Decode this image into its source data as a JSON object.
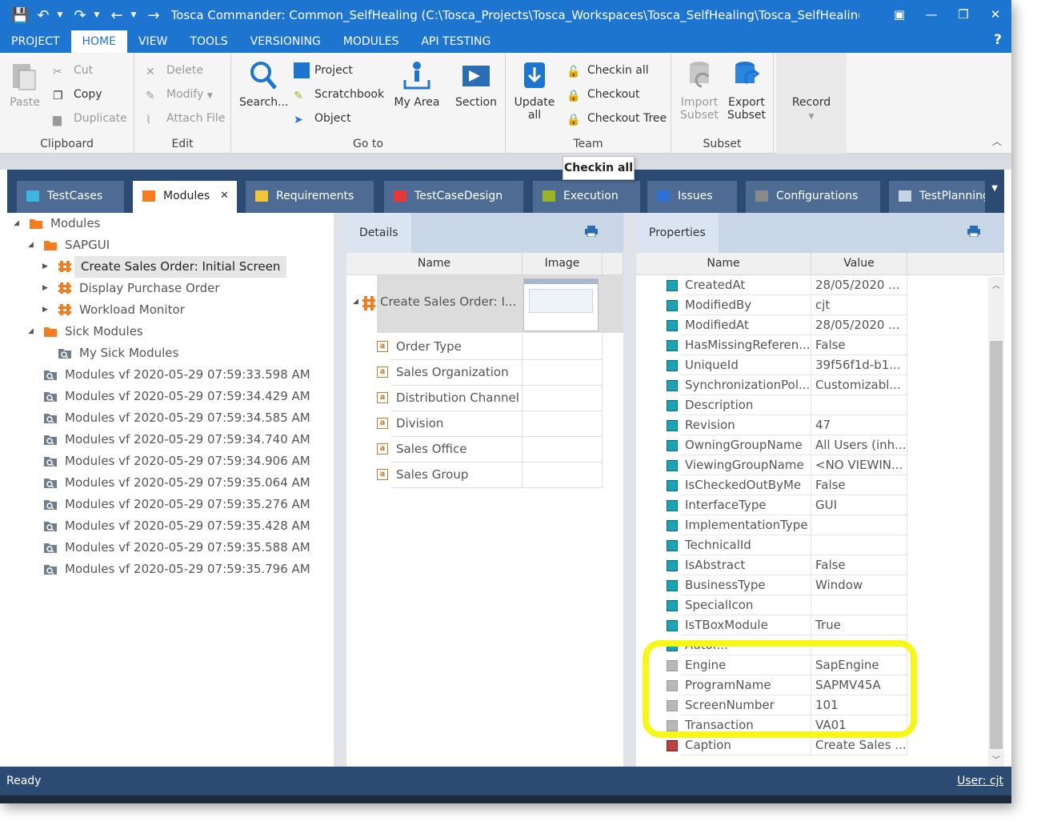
{
  "window": {
    "title": "Tosca Commander: Common_SelfHealing (C:\\Tosca_Projects\\Tosca_Workspaces\\Tosca_SelfHealing\\Tosca_SelfHealing.tws [Bran...",
    "accent": "#1e75cf"
  },
  "menu": {
    "tabs": [
      "PROJECT",
      "HOME",
      "VIEW",
      "TOOLS",
      "VERSIONING",
      "MODULES",
      "API TESTING"
    ],
    "active": "HOME",
    "help": "?"
  },
  "ribbon": {
    "clipboard": {
      "label": "Clipboard",
      "paste": "Paste",
      "cut": "Cut",
      "copy": "Copy",
      "duplicate": "Duplicate"
    },
    "edit": {
      "label": "Edit",
      "delete": "Delete",
      "modify": "Modify",
      "attach_file": "Attach File"
    },
    "goto": {
      "label": "Go to",
      "search": "Search...",
      "project": "Project",
      "scratchbook": "Scratchbook",
      "object": "Object",
      "my_area": "My Area",
      "section": "Section"
    },
    "team": {
      "label": "Team",
      "update_all_1": "Update",
      "update_all_2": "all",
      "checkin_all": "Checkin all",
      "checkout": "Checkout",
      "checkout_tree": "Checkout Tree"
    },
    "subset": {
      "label": "Subset",
      "import_1": "Import",
      "import_2": "Subset",
      "export_1": "Export",
      "export_2": "Subset"
    },
    "record": {
      "label": "Record"
    }
  },
  "tooltip": "Checkin all",
  "tabs": [
    {
      "label": "TestCases",
      "color": "#39b7e0"
    },
    {
      "label": "Modules",
      "color": "#f57c1f"
    },
    {
      "label": "Requirements",
      "color": "#f3c33a"
    },
    {
      "label": "TestCaseDesign",
      "color": "#e53935"
    },
    {
      "label": "Execution",
      "color": "#9ab42a"
    },
    {
      "label": "Issues",
      "color": "#2f6fd0"
    },
    {
      "label": "Configurations",
      "color": "#8a8a8a"
    },
    {
      "label": "TestPlanning",
      "color": "#4a6a9a"
    }
  ],
  "tree": [
    {
      "label": "Modules",
      "level": 0,
      "arrow": "down",
      "icon": "folder-orange"
    },
    {
      "label": "SAPGUI",
      "level": 1,
      "arrow": "down",
      "icon": "folder-orange"
    },
    {
      "label": "Create Sales Order: Initial Screen",
      "level": 2,
      "arrow": "right",
      "icon": "module",
      "selected": true
    },
    {
      "label": "Display Purchase Order",
      "level": 2,
      "arrow": "right",
      "icon": "module"
    },
    {
      "label": "Workload Monitor",
      "level": 2,
      "arrow": "right",
      "icon": "module"
    },
    {
      "label": "Sick Modules",
      "level": 1,
      "arrow": "down",
      "icon": "folder-orange"
    },
    {
      "label": "My Sick Modules",
      "level": 2,
      "arrow": "",
      "icon": "virtual-folder"
    },
    {
      "label": "Modules vf 2020-05-29 07:59:33.598 AM",
      "level": 1,
      "arrow": "",
      "icon": "virtual-folder"
    },
    {
      "label": "Modules vf 2020-05-29 07:59:34.429 AM",
      "level": 1,
      "arrow": "",
      "icon": "virtual-folder"
    },
    {
      "label": "Modules vf 2020-05-29 07:59:34.585 AM",
      "level": 1,
      "arrow": "",
      "icon": "virtual-folder"
    },
    {
      "label": "Modules vf 2020-05-29 07:59:34.740 AM",
      "level": 1,
      "arrow": "",
      "icon": "virtual-folder"
    },
    {
      "label": "Modules vf 2020-05-29 07:59:34.906 AM",
      "level": 1,
      "arrow": "",
      "icon": "virtual-folder"
    },
    {
      "label": "Modules vf 2020-05-29 07:59:35.064 AM",
      "level": 1,
      "arrow": "",
      "icon": "virtual-folder"
    },
    {
      "label": "Modules vf 2020-05-29 07:59:35.276 AM",
      "level": 1,
      "arrow": "",
      "icon": "virtual-folder"
    },
    {
      "label": "Modules vf 2020-05-29 07:59:35.428 AM",
      "level": 1,
      "arrow": "",
      "icon": "virtual-folder"
    },
    {
      "label": "Modules vf 2020-05-29 07:59:35.588 AM",
      "level": 1,
      "arrow": "",
      "icon": "virtual-folder"
    },
    {
      "label": "Modules vf 2020-05-29 07:59:35.796 AM",
      "level": 1,
      "arrow": "",
      "icon": "virtual-folder"
    }
  ],
  "details": {
    "tab": "Details",
    "columns": [
      "Name",
      "Image"
    ],
    "module_name": "Create Sales Order: I...",
    "attributes": [
      "Order Type",
      "Sales Organization",
      "Distribution Channel",
      "Division",
      "Sales Office",
      "Sales Group"
    ]
  },
  "properties": {
    "tab": "Properties",
    "columns": [
      "Name",
      "Value"
    ],
    "rows": [
      {
        "name": "CreatedAt",
        "value": "28/05/2020 ...",
        "icon": "teal"
      },
      {
        "name": "ModifiedBy",
        "value": "cjt",
        "icon": "teal"
      },
      {
        "name": "ModifiedAt",
        "value": "28/05/2020 ...",
        "icon": "teal"
      },
      {
        "name": "HasMissingReferen...",
        "value": "False",
        "icon": "teal"
      },
      {
        "name": "UniqueId",
        "value": "39f56f1d-b1...",
        "icon": "teal"
      },
      {
        "name": "SynchronizationPol...",
        "value": "Customizabl...",
        "icon": "teal"
      },
      {
        "name": "Description",
        "value": "",
        "icon": "teal"
      },
      {
        "name": "Revision",
        "value": "47",
        "icon": "teal"
      },
      {
        "name": "OwningGroupName",
        "value": "All Users (inh...",
        "icon": "teal"
      },
      {
        "name": "ViewingGroupName",
        "value": "<NO VIEWIN...",
        "icon": "teal"
      },
      {
        "name": "IsCheckedOutByMe",
        "value": "False",
        "icon": "teal"
      },
      {
        "name": "InterfaceType",
        "value": "GUI",
        "icon": "teal"
      },
      {
        "name": "ImplementationType",
        "value": "",
        "icon": "teal"
      },
      {
        "name": "TechnicalId",
        "value": "",
        "icon": "teal"
      },
      {
        "name": "IsAbstract",
        "value": "False",
        "icon": "teal"
      },
      {
        "name": "BusinessType",
        "value": "Window",
        "icon": "teal"
      },
      {
        "name": "SpecialIcon",
        "value": "",
        "icon": "teal"
      },
      {
        "name": "IsTBoxModule",
        "value": "True",
        "icon": "teal"
      },
      {
        "name": "Autor...",
        "value": "",
        "icon": "teal"
      },
      {
        "name": "Engine",
        "value": "SapEngine",
        "icon": "gray"
      },
      {
        "name": "ProgramName",
        "value": "SAPMV45A",
        "icon": "gray"
      },
      {
        "name": "ScreenNumber",
        "value": "101",
        "icon": "gray"
      },
      {
        "name": "Transaction",
        "value": "VA01",
        "icon": "gray"
      },
      {
        "name": "Caption",
        "value": "Create Sales ...",
        "icon": "red"
      }
    ]
  },
  "status": {
    "left": "Ready",
    "right": "User: cjt"
  }
}
